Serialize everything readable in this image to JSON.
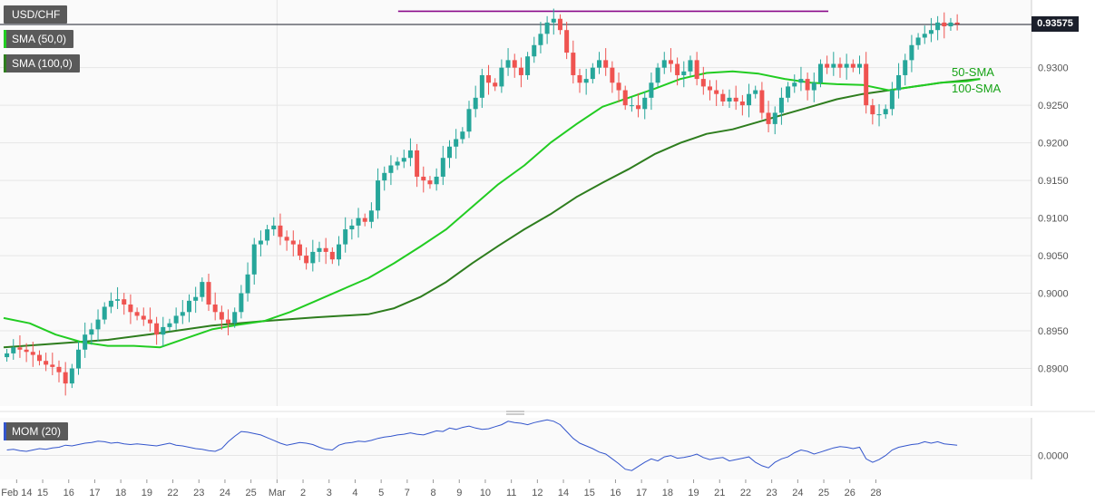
{
  "colors": {
    "up": "#26a69a",
    "down": "#ef5350",
    "sma50": "#22cc22",
    "sma100": "#2e7d1e",
    "resistance": "#8b0b8b",
    "momentum": "#3355cc",
    "grid": "#e6e6e6",
    "background": "#fafafa"
  },
  "legend": {
    "symbol": "USD/CHF",
    "sma50": "SMA (50,0)",
    "sma100": "SMA (100,0)",
    "momentum": "MOM (20)"
  },
  "price_tag": "0.93575",
  "annotations": {
    "sma50_label": "50-SMA",
    "sma100_label": "100-SMA"
  },
  "chart_data": [
    {
      "type": "candlestick",
      "title": "USD/CHF",
      "ylim": [
        0.885,
        0.939
      ],
      "y_ticks": [
        "0.8900",
        "0.8950",
        "0.9000",
        "0.9050",
        "0.9100",
        "0.9150",
        "0.9200",
        "0.9250",
        "0.9300"
      ],
      "y_tick_values": [
        0.89,
        0.895,
        0.9,
        0.905,
        0.91,
        0.915,
        0.92,
        0.925,
        0.93
      ],
      "x_labels": [
        "Feb 14",
        "15",
        "16",
        "17",
        "18",
        "19",
        "22",
        "23",
        "24",
        "25",
        "Mar",
        "2",
        "3",
        "4",
        "5",
        "7",
        "8",
        "9",
        "10",
        "11",
        "12",
        "14",
        "15",
        "16",
        "17",
        "18",
        "19",
        "21",
        "22",
        "23",
        "24",
        "25",
        "26",
        "28"
      ],
      "bars_per_day": 4,
      "resistance": {
        "level": 0.9375,
        "from_day": 15,
        "to_day": 31
      },
      "last_price": 0.93575,
      "candle_closes": [
        0.892,
        0.8928,
        0.8925,
        0.8922,
        0.8918,
        0.891,
        0.8905,
        0.8902,
        0.8895,
        0.888,
        0.89,
        0.8925,
        0.8945,
        0.8952,
        0.8965,
        0.8982,
        0.899,
        0.8992,
        0.8985,
        0.8975,
        0.897,
        0.8965,
        0.896,
        0.8945,
        0.8955,
        0.896,
        0.897,
        0.8975,
        0.899,
        0.8995,
        0.9015,
        0.8985,
        0.8975,
        0.8965,
        0.896,
        0.8975,
        0.9,
        0.9025,
        0.9065,
        0.907,
        0.9085,
        0.909,
        0.9075,
        0.907,
        0.9065,
        0.905,
        0.904,
        0.9055,
        0.906,
        0.9055,
        0.9045,
        0.9065,
        0.9085,
        0.909,
        0.91,
        0.9095,
        0.911,
        0.915,
        0.916,
        0.917,
        0.9175,
        0.918,
        0.919,
        0.9155,
        0.915,
        0.9145,
        0.9155,
        0.918,
        0.9195,
        0.9205,
        0.9215,
        0.9245,
        0.926,
        0.929,
        0.928,
        0.9275,
        0.93,
        0.931,
        0.93,
        0.929,
        0.9315,
        0.933,
        0.9345,
        0.936,
        0.9365,
        0.935,
        0.932,
        0.929,
        0.928,
        0.9285,
        0.93,
        0.931,
        0.93,
        0.928,
        0.927,
        0.925,
        0.925,
        0.9245,
        0.926,
        0.928,
        0.93,
        0.931,
        0.9305,
        0.929,
        0.9295,
        0.931,
        0.9285,
        0.9275,
        0.927,
        0.9265,
        0.9255,
        0.926,
        0.9255,
        0.925,
        0.9265,
        0.927,
        0.924,
        0.9225,
        0.924,
        0.926,
        0.9275,
        0.928,
        0.9285,
        0.927,
        0.928,
        0.9305,
        0.93,
        0.9305,
        0.93,
        0.9305,
        0.93,
        0.9305,
        0.925,
        0.9238,
        0.9238,
        0.9245,
        0.927,
        0.929,
        0.931,
        0.933,
        0.934,
        0.9345,
        0.935,
        0.936,
        0.9355,
        0.936,
        0.9358
      ],
      "sma50": [
        [
          0,
          0.8967
        ],
        [
          4,
          0.896
        ],
        [
          8,
          0.8945
        ],
        [
          12,
          0.8935
        ],
        [
          16,
          0.893
        ],
        [
          20,
          0.893
        ],
        [
          24,
          0.8928
        ],
        [
          28,
          0.894
        ],
        [
          32,
          0.8952
        ],
        [
          36,
          0.8958
        ],
        [
          40,
          0.8963
        ],
        [
          44,
          0.8975
        ],
        [
          48,
          0.899
        ],
        [
          52,
          0.9005
        ],
        [
          56,
          0.902
        ],
        [
          60,
          0.904
        ],
        [
          64,
          0.9062
        ],
        [
          68,
          0.9085
        ],
        [
          72,
          0.9115
        ],
        [
          76,
          0.9145
        ],
        [
          80,
          0.917
        ],
        [
          84,
          0.92
        ],
        [
          88,
          0.9225
        ],
        [
          92,
          0.9248
        ],
        [
          96,
          0.926
        ],
        [
          100,
          0.9272
        ],
        [
          104,
          0.9285
        ],
        [
          108,
          0.9293
        ],
        [
          112,
          0.9295
        ],
        [
          116,
          0.9292
        ],
        [
          120,
          0.9285
        ],
        [
          124,
          0.928
        ],
        [
          128,
          0.9278
        ],
        [
          132,
          0.9277
        ],
        [
          136,
          0.927
        ],
        [
          140,
          0.9275
        ],
        [
          144,
          0.928
        ],
        [
          148,
          0.9282
        ],
        [
          150,
          0.9285
        ]
      ],
      "sma100": [
        [
          0,
          0.8928
        ],
        [
          8,
          0.8933
        ],
        [
          16,
          0.8938
        ],
        [
          24,
          0.8947
        ],
        [
          32,
          0.8957
        ],
        [
          40,
          0.8963
        ],
        [
          48,
          0.8968
        ],
        [
          56,
          0.8972
        ],
        [
          60,
          0.898
        ],
        [
          64,
          0.8995
        ],
        [
          68,
          0.9015
        ],
        [
          72,
          0.904
        ],
        [
          76,
          0.9063
        ],
        [
          80,
          0.9085
        ],
        [
          84,
          0.9105
        ],
        [
          88,
          0.9128
        ],
        [
          92,
          0.9147
        ],
        [
          96,
          0.9165
        ],
        [
          100,
          0.9185
        ],
        [
          104,
          0.92
        ],
        [
          108,
          0.9212
        ],
        [
          112,
          0.9218
        ],
        [
          116,
          0.9228
        ],
        [
          120,
          0.9238
        ],
        [
          124,
          0.9248
        ],
        [
          128,
          0.9258
        ],
        [
          132,
          0.9265
        ],
        [
          136,
          0.927
        ],
        [
          140,
          0.9275
        ],
        [
          144,
          0.928
        ],
        [
          150,
          0.9285
        ]
      ]
    },
    {
      "type": "line",
      "title": "MOM (20)",
      "ylim": [
        -0.0035,
        0.0055
      ],
      "y_ticks": [
        "0.0000"
      ],
      "y_tick_values": [
        0.0
      ],
      "values": [
        0.0008,
        0.0009,
        0.0007,
        0.0006,
        0.0008,
        0.001,
        0.0009,
        0.0011,
        0.0012,
        0.0015,
        0.0014,
        0.0016,
        0.0018,
        0.0019,
        0.0021,
        0.002,
        0.0018,
        0.0019,
        0.0017,
        0.0016,
        0.0017,
        0.0016,
        0.0015,
        0.0014,
        0.0016,
        0.0018,
        0.0015,
        0.0014,
        0.0012,
        0.001,
        0.0009,
        0.0007,
        0.0006,
        0.001,
        0.002,
        0.0028,
        0.0035,
        0.0034,
        0.0032,
        0.003,
        0.0026,
        0.0022,
        0.0018,
        0.0015,
        0.0017,
        0.0019,
        0.0018,
        0.0016,
        0.0012,
        0.0009,
        0.0008,
        0.0015,
        0.0018,
        0.0019,
        0.0021,
        0.002,
        0.0022,
        0.0025,
        0.0027,
        0.0028,
        0.003,
        0.0031,
        0.0033,
        0.0031,
        0.003,
        0.0033,
        0.0036,
        0.0035,
        0.004,
        0.0038,
        0.0041,
        0.0043,
        0.004,
        0.0038,
        0.0039,
        0.0042,
        0.0045,
        0.005,
        0.0048,
        0.0047,
        0.0045,
        0.0048,
        0.005,
        0.0052,
        0.005,
        0.0045,
        0.0035,
        0.0025,
        0.0018,
        0.0014,
        0.001,
        0.0005,
        0.0002,
        -0.0005,
        -0.0012,
        -0.002,
        -0.0022,
        -0.0016,
        -0.001,
        -0.0005,
        -0.0008,
        -0.0002,
        0.0,
        -0.0004,
        -0.0003,
        -0.0001,
        0.0002,
        -0.0003,
        -0.0006,
        -0.0004,
        -0.0003,
        -0.0008,
        -0.0006,
        -0.0004,
        -0.0002,
        -0.001,
        -0.0015,
        -0.0018,
        -0.001,
        -0.0005,
        -0.0002,
        0.0004,
        0.0008,
        0.0006,
        0.0002,
        0.0005,
        0.0008,
        0.0011,
        0.0013,
        0.0012,
        0.001,
        0.0012,
        -0.0005,
        -0.001,
        -0.0006,
        0.0,
        0.0008,
        0.0012,
        0.0014,
        0.0016,
        0.0017,
        0.002,
        0.0018,
        0.002,
        0.0017,
        0.0016,
        0.0015
      ]
    }
  ]
}
